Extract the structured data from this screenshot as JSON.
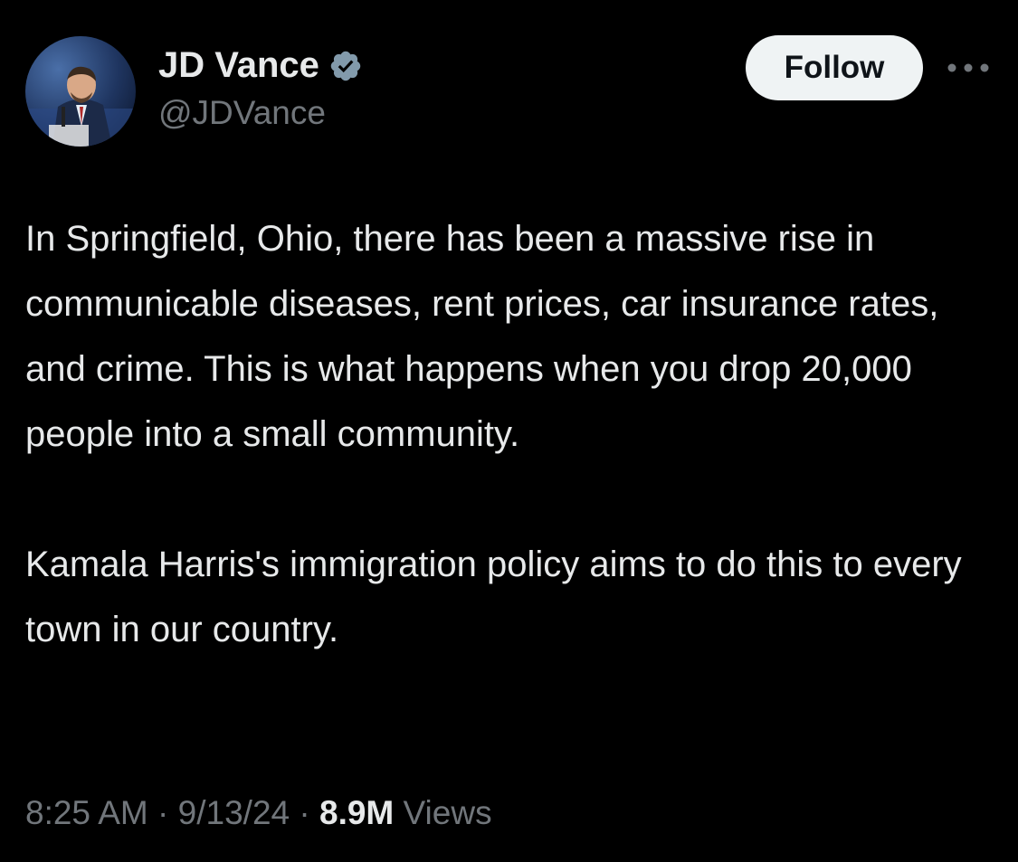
{
  "author": {
    "display_name": "JD Vance",
    "handle": "@JDVance",
    "verified_icon": "verified-badge-icon"
  },
  "actions": {
    "follow_label": "Follow",
    "more_icon": "more-horizontal-icon"
  },
  "tweet": {
    "paragraph_1": "In Springfield, Ohio, there has been a massive rise in communicable diseases, rent prices, car insurance rates, and crime. This is what happens when you drop 20,000 people into a small community.",
    "paragraph_2": "Kamala Harris's immigration policy aims to do this to every town in our country."
  },
  "meta": {
    "time": "8:25 AM",
    "separator": "·",
    "date": "9/13/24",
    "views_count": "8.9M",
    "views_label": "Views"
  },
  "colors": {
    "background": "#000000",
    "primary_text": "#e7e9ea",
    "secondary_text": "#71767b",
    "follow_button_bg": "#eff3f4",
    "verified_badge": "#829aab"
  }
}
